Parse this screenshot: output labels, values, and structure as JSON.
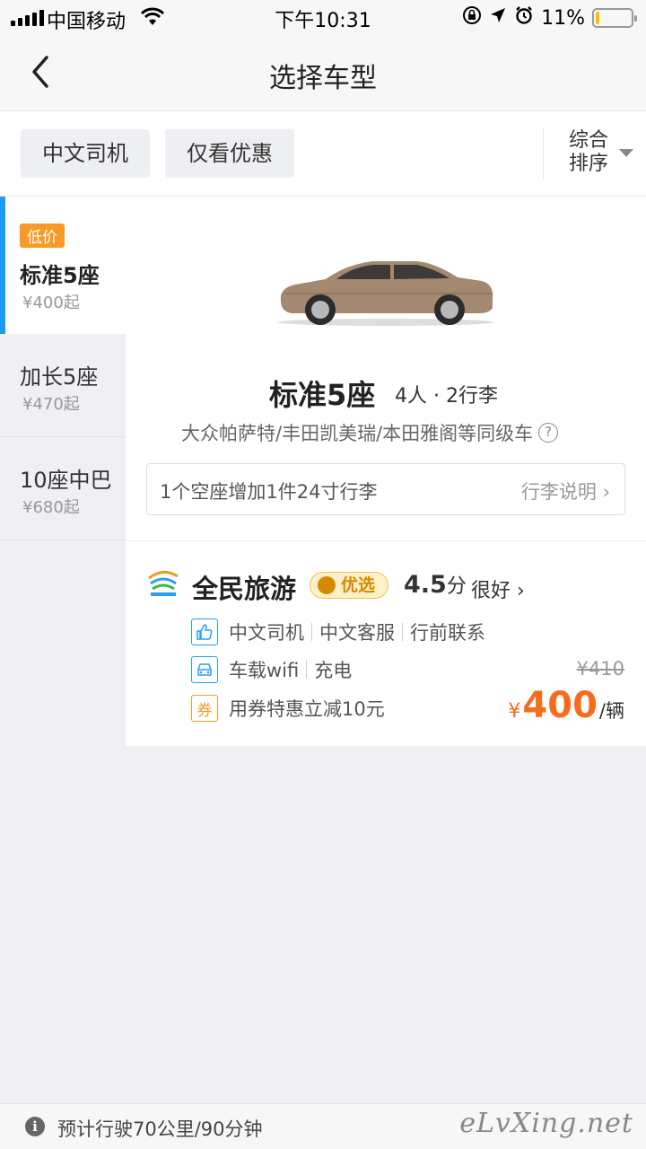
{
  "status_bar": {
    "carrier": "中国移动",
    "time": "下午10:31",
    "battery_percent": "11%",
    "battery_level": 0.11
  },
  "nav": {
    "title": "选择车型"
  },
  "filters": {
    "chips": [
      "中文司机",
      "仅看优惠"
    ],
    "sort_line1": "综合",
    "sort_line2": "排序"
  },
  "sidebar": {
    "items": [
      {
        "badge": "低价",
        "name": "标准5座",
        "price": "¥400起",
        "active": true
      },
      {
        "name": "加长5座",
        "price": "¥470起",
        "active": false
      },
      {
        "name": "10座中巴",
        "price": "¥680起",
        "active": false
      }
    ]
  },
  "car": {
    "title": "标准5座",
    "capacity": "4人 · 2行李",
    "models": "大众帕萨特/丰田凯美瑞/本田雅阁等同级车",
    "help_icon": "question-icon",
    "luggage_note": "1个空座增加1件24寸行李",
    "luggage_link": "行李说明 ›"
  },
  "vendor": {
    "name": "全民旅游",
    "badge": "优选",
    "score": "4.5",
    "score_unit": "分",
    "rating": "很好 ›",
    "features_row1": [
      "中文司机",
      "中文客服",
      "行前联系"
    ],
    "features_row2": [
      "车载wifi",
      "充电"
    ],
    "coupon_icon_text": "券",
    "coupon_text": "用券特惠立减10元",
    "old_price": "¥410",
    "price_symbol": "¥",
    "price": "400",
    "price_unit": "/辆"
  },
  "footer": {
    "info_icon": "i",
    "eta": "预计行驶70公里/90分钟",
    "watermark": "eLvXing.net"
  },
  "colors": {
    "accent_blue": "#1d9bf0",
    "price_orange": "#f76b1c",
    "badge_orange": "#f79a26"
  }
}
